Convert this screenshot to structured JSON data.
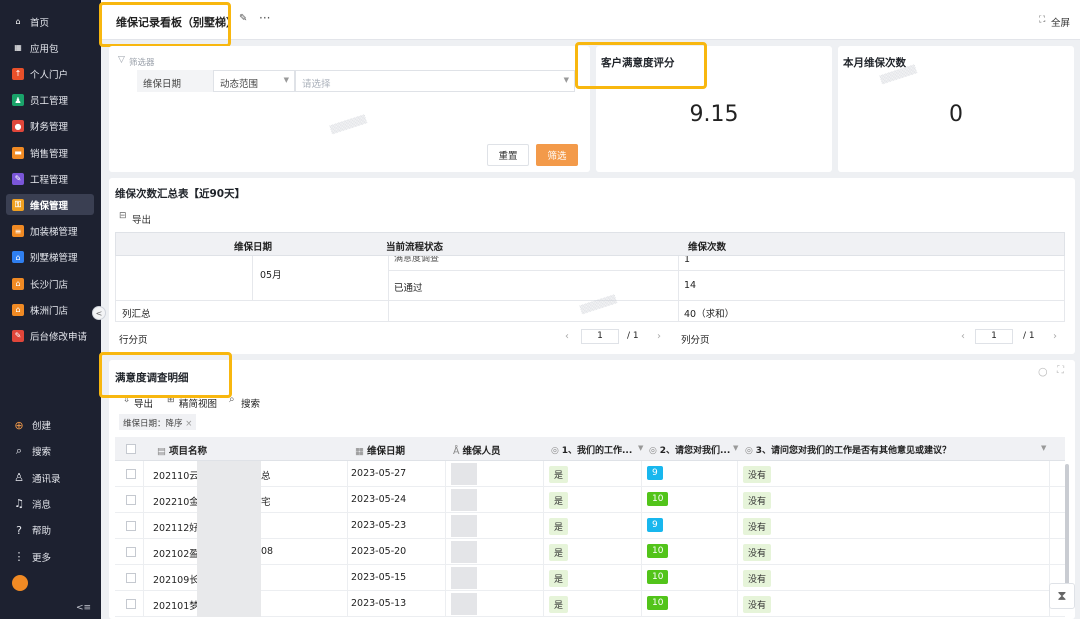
{
  "sidebar": {
    "items": [
      {
        "label": "首页",
        "icon": "home-icon"
      },
      {
        "label": "应用包",
        "icon": "grid-icon"
      },
      {
        "label": "个人门户",
        "icon": "portal-icon",
        "color": "#e8502a"
      },
      {
        "label": "员工管理",
        "icon": "people-icon",
        "color": "#1aa36a"
      },
      {
        "label": "财务管理",
        "icon": "finance-icon",
        "color": "#e0463a"
      },
      {
        "label": "销售管理",
        "icon": "sales-icon",
        "color": "#f08a24"
      },
      {
        "label": "工程管理",
        "icon": "wrench-icon",
        "color": "#7a56d8"
      },
      {
        "label": "维保管理",
        "icon": "key-icon",
        "color": "#f0a020"
      },
      {
        "label": "加装梯管理",
        "icon": "elevator-icon",
        "color": "#f08a24"
      },
      {
        "label": "别墅梯管理",
        "icon": "house-icon",
        "color": "#2f7ff0"
      },
      {
        "label": "长沙门店",
        "icon": "store-icon",
        "color": "#f08a24"
      },
      {
        "label": "株洲门店",
        "icon": "store-icon",
        "color": "#f08a24"
      },
      {
        "label": "后台修改申请",
        "icon": "edit-icon",
        "color": "#e0463a"
      }
    ],
    "bottom": [
      {
        "label": "创建",
        "icon": "plus-icon"
      },
      {
        "label": "搜索",
        "icon": "search-icon"
      },
      {
        "label": "通讯录",
        "icon": "contacts-icon"
      },
      {
        "label": "消息",
        "icon": "bell-icon"
      },
      {
        "label": "帮助",
        "icon": "help-icon"
      },
      {
        "label": "更多",
        "icon": "more-icon"
      }
    ],
    "collapse": "<",
    "menu_glyph": "<≡"
  },
  "topbar": {
    "title": "维保记录看板（别墅梯）",
    "fullscreen": "全屏"
  },
  "filter": {
    "label": "筛选器",
    "field": "维保日期",
    "range": "动态范围",
    "placeholder": "请选择",
    "reset": "重置",
    "submit": "筛选"
  },
  "kpis": [
    {
      "title": "客户满意度评分",
      "value": "9.15"
    },
    {
      "title": "本月维保次数",
      "value": "0"
    }
  ],
  "summary": {
    "title": "维保次数汇总表【近90天】",
    "export": "导出",
    "headers": [
      "维保日期",
      "当前流程状态",
      "维保次数"
    ],
    "month": "05月",
    "rows": [
      {
        "status": "满意度调查",
        "count": "1"
      },
      {
        "status": "已通过",
        "count": "14"
      }
    ],
    "total_label": "列汇总",
    "total_value": "40（求和）",
    "row_pager": "行分页",
    "col_pager": "列分页",
    "page": "1",
    "pages": "1"
  },
  "detail": {
    "title": "满意度调查明细",
    "toolbar": [
      "导出",
      "精简视图",
      "搜索"
    ],
    "sort_chip": "维保日期：降序",
    "columns": [
      "项目名称",
      "维保日期",
      "维保人员",
      "1、我们的工作...",
      "2、请您对我们...",
      "3、请问您对我们的工作是否有其他意见或建议？"
    ],
    "rows": [
      {
        "name": "202110云",
        "name_tail": "总",
        "date": "2023-05-27",
        "q1": "是",
        "q2": "9",
        "q3": "没有"
      },
      {
        "name": "202210金",
        "name_tail": "宅",
        "date": "2023-05-24",
        "q1": "是",
        "q2": "10",
        "q3": "没有"
      },
      {
        "name": "202112好",
        "name_tail": "",
        "date": "2023-05-23",
        "q1": "是",
        "q2": "9",
        "q3": "没有"
      },
      {
        "name": "202102盈",
        "name_tail": "08",
        "date": "2023-05-20",
        "q1": "是",
        "q2": "10",
        "q3": "没有"
      },
      {
        "name": "202109长",
        "name_tail": "",
        "date": "2023-05-15",
        "q1": "是",
        "q2": "10",
        "q3": "没有"
      },
      {
        "name": "202101梦",
        "name_tail": "",
        "date": "2023-05-13",
        "q1": "是",
        "q2": "10",
        "q3": "没有"
      }
    ]
  },
  "colors": {
    "highlight": "#f8b70f",
    "primary_btn": "#f39a4a",
    "sidebar_bg": "#1d2130"
  }
}
